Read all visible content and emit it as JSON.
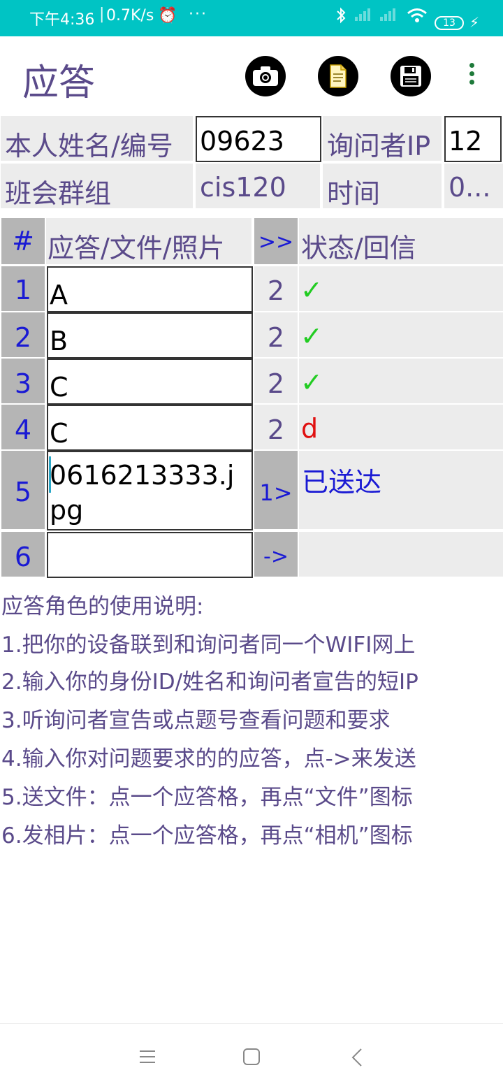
{
  "status_bar": {
    "time": "下午4:36",
    "separator": "|",
    "network_speed": "0.7K/s",
    "alarm_icon": "alarm-icon",
    "more_icon": "···",
    "battery_level": "13",
    "color": "#00c4c4"
  },
  "app_bar": {
    "title": "应答",
    "icons": [
      "camera-icon",
      "file-icon",
      "save-icon",
      "overflow-menu-icon"
    ]
  },
  "info": {
    "name_label": "本人姓名/编号",
    "name_value": "09623",
    "ip_label": "询问者IP",
    "ip_value": "12",
    "group_label": "班会群组",
    "group_value": "cis120",
    "time_label": "时间",
    "time_value": "0..."
  },
  "table": {
    "headers": {
      "num": "#",
      "answer": "应答/文件/照片",
      "send": ">>",
      "status": "状态/回信"
    },
    "rows": [
      {
        "num": "1",
        "answer": "A",
        "mid": "2",
        "status": "✓"
      },
      {
        "num": "2",
        "answer": "B",
        "mid": "2",
        "status": "✓"
      },
      {
        "num": "3",
        "answer": "C",
        "mid": "2",
        "status": "✓"
      },
      {
        "num": "4",
        "answer": "C",
        "mid": "2",
        "status": "d"
      },
      {
        "num": "5",
        "answer": "0616213333.jpg",
        "mid": "1>",
        "status": "已送达"
      },
      {
        "num": "6",
        "answer": "",
        "mid": "->",
        "status": ""
      }
    ]
  },
  "instructions": {
    "title": "应答角色的使用说明:",
    "lines": [
      "1.把你的设备联到和询问者同一个WIFI网上",
      "2.输入你的身份ID/姓名和询问者宣告的短IP",
      "3.听询问者宣告或点题号查看问题和要求",
      "4.输入你对问题要求的的应答，点->来发送",
      "5.送文件：点一个应答格，再点“文件”图标",
      "6.发相片：点一个应答格，再点“相机”图标"
    ]
  },
  "nav_bar": {
    "icons": [
      "menu-icon",
      "home-icon",
      "back-icon"
    ]
  }
}
